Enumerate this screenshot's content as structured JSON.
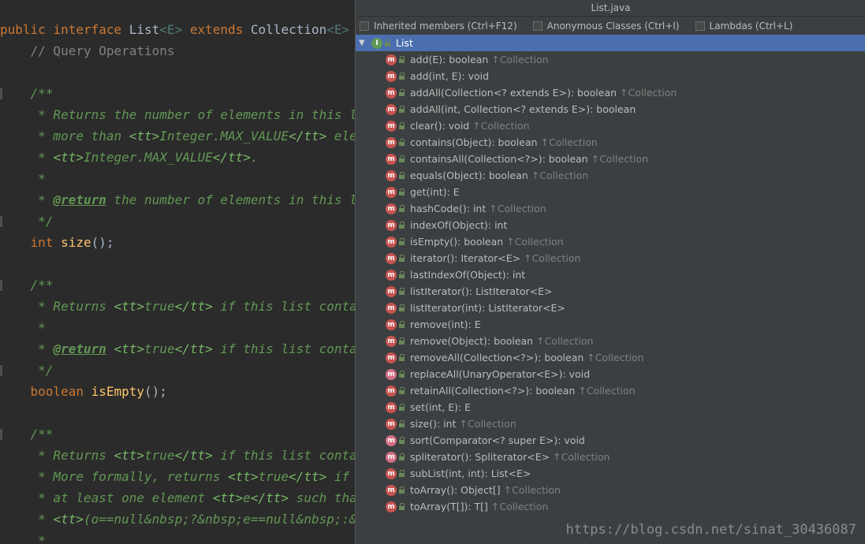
{
  "editor": {
    "lines": [
      [
        {
          "t": "public ",
          "c": "kw"
        },
        {
          "t": "interface ",
          "c": "kw"
        },
        {
          "t": "List",
          "c": "cls"
        },
        {
          "t": "<E>",
          "c": "typep"
        },
        {
          "t": " extends ",
          "c": "kw"
        },
        {
          "t": "Collection",
          "c": "cls"
        },
        {
          "t": "<E>",
          "c": "typep"
        },
        {
          "t": " ",
          "c": "cls"
        },
        {
          "t": "{",
          "c": "brace-hl"
        }
      ],
      [
        {
          "t": "    // Query Operations",
          "c": "cmt-plain"
        }
      ],
      [
        {
          "t": "",
          "c": "cls"
        }
      ],
      [
        {
          "t": "    /**",
          "c": "doc"
        }
      ],
      [
        {
          "t": "     * Returns the number of elements in this list",
          "c": "doc"
        }
      ],
      [
        {
          "t": "     * more than ",
          "c": "doc"
        },
        {
          "t": "<tt>",
          "c": "doc-html"
        },
        {
          "t": "Integer.MAX_VALUE",
          "c": "doc"
        },
        {
          "t": "</tt>",
          "c": "doc-html"
        },
        {
          "t": " elements",
          "c": "doc"
        }
      ],
      [
        {
          "t": "     * ",
          "c": "doc"
        },
        {
          "t": "<tt>",
          "c": "doc-html"
        },
        {
          "t": "Integer.MAX_VALUE",
          "c": "doc"
        },
        {
          "t": "</tt>",
          "c": "doc-html"
        },
        {
          "t": ".",
          "c": "doc"
        }
      ],
      [
        {
          "t": "     *",
          "c": "doc"
        }
      ],
      [
        {
          "t": "     * ",
          "c": "doc"
        },
        {
          "t": "@return",
          "c": "doc-tag"
        },
        {
          "t": " the number of elements in this list",
          "c": "doc"
        }
      ],
      [
        {
          "t": "     */",
          "c": "doc"
        }
      ],
      [
        {
          "t": "    int ",
          "c": "kw"
        },
        {
          "t": "size",
          "c": "fn"
        },
        {
          "t": "();",
          "c": "cls"
        }
      ],
      [
        {
          "t": "",
          "c": "cls"
        }
      ],
      [
        {
          "t": "    /**",
          "c": "doc"
        }
      ],
      [
        {
          "t": "     * Returns ",
          "c": "doc"
        },
        {
          "t": "<tt>",
          "c": "doc-html"
        },
        {
          "t": "true",
          "c": "doc"
        },
        {
          "t": "</tt>",
          "c": "doc-html"
        },
        {
          "t": " if this list contains",
          "c": "doc"
        }
      ],
      [
        {
          "t": "     *",
          "c": "doc"
        }
      ],
      [
        {
          "t": "     * ",
          "c": "doc"
        },
        {
          "t": "@return",
          "c": "doc-tag"
        },
        {
          "t": " ",
          "c": "doc"
        },
        {
          "t": "<tt>",
          "c": "doc-html"
        },
        {
          "t": "true",
          "c": "doc"
        },
        {
          "t": "</tt>",
          "c": "doc-html"
        },
        {
          "t": " if this list contains",
          "c": "doc"
        }
      ],
      [
        {
          "t": "     */",
          "c": "doc"
        }
      ],
      [
        {
          "t": "    boolean ",
          "c": "kw"
        },
        {
          "t": "isEmpty",
          "c": "fn"
        },
        {
          "t": "();",
          "c": "cls"
        }
      ],
      [
        {
          "t": "",
          "c": "cls"
        }
      ],
      [
        {
          "t": "    /**",
          "c": "doc"
        }
      ],
      [
        {
          "t": "     * Returns ",
          "c": "doc"
        },
        {
          "t": "<tt>",
          "c": "doc-html"
        },
        {
          "t": "true",
          "c": "doc"
        },
        {
          "t": "</tt>",
          "c": "doc-html"
        },
        {
          "t": " if this list contains",
          "c": "doc"
        }
      ],
      [
        {
          "t": "     * More formally, returns ",
          "c": "doc"
        },
        {
          "t": "<tt>",
          "c": "doc-html"
        },
        {
          "t": "true",
          "c": "doc"
        },
        {
          "t": "</tt>",
          "c": "doc-html"
        },
        {
          "t": " if and",
          "c": "doc"
        }
      ],
      [
        {
          "t": "     * at least one element ",
          "c": "doc"
        },
        {
          "t": "<tt>",
          "c": "doc-html"
        },
        {
          "t": "e",
          "c": "doc"
        },
        {
          "t": "</tt>",
          "c": "doc-html"
        },
        {
          "t": " such that",
          "c": "doc"
        }
      ],
      [
        {
          "t": "     * ",
          "c": "doc"
        },
        {
          "t": "<tt>",
          "c": "doc-html"
        },
        {
          "t": "(o==null&nbsp;?&nbsp;e==null&nbsp;:&nbsp;",
          "c": "doc"
        }
      ],
      [
        {
          "t": "     *",
          "c": "doc"
        }
      ]
    ]
  },
  "popup": {
    "title": "List.java",
    "filters": [
      {
        "label": "Inherited members (Ctrl+F12)",
        "checked": false
      },
      {
        "label": "Anonymous Classes (Ctrl+I)",
        "checked": false
      },
      {
        "label": "Lambdas (Ctrl+L)",
        "checked": false
      }
    ],
    "root": {
      "label": "List",
      "icon": "interface-icon"
    },
    "members": [
      {
        "sig": "add(E): boolean",
        "inh": "↑Collection",
        "default": false
      },
      {
        "sig": "add(int, E): void",
        "inh": "",
        "default": false
      },
      {
        "sig": "addAll(Collection<? extends E>): boolean",
        "inh": "↑Collection",
        "default": false
      },
      {
        "sig": "addAll(int, Collection<? extends E>): boolean",
        "inh": "",
        "default": false
      },
      {
        "sig": "clear(): void",
        "inh": "↑Collection",
        "default": false
      },
      {
        "sig": "contains(Object): boolean",
        "inh": "↑Collection",
        "default": false
      },
      {
        "sig": "containsAll(Collection<?>): boolean",
        "inh": "↑Collection",
        "default": false
      },
      {
        "sig": "equals(Object): boolean",
        "inh": "↑Collection",
        "default": false
      },
      {
        "sig": "get(int): E",
        "inh": "",
        "default": false
      },
      {
        "sig": "hashCode(): int",
        "inh": "↑Collection",
        "default": false
      },
      {
        "sig": "indexOf(Object): int",
        "inh": "",
        "default": false
      },
      {
        "sig": "isEmpty(): boolean",
        "inh": "↑Collection",
        "default": false
      },
      {
        "sig": "iterator(): Iterator<E>",
        "inh": "↑Collection",
        "default": false
      },
      {
        "sig": "lastIndexOf(Object): int",
        "inh": "",
        "default": false
      },
      {
        "sig": "listIterator(): ListIterator<E>",
        "inh": "",
        "default": false
      },
      {
        "sig": "listIterator(int): ListIterator<E>",
        "inh": "",
        "default": false
      },
      {
        "sig": "remove(int): E",
        "inh": "",
        "default": false
      },
      {
        "sig": "remove(Object): boolean",
        "inh": "↑Collection",
        "default": false
      },
      {
        "sig": "removeAll(Collection<?>): boolean",
        "inh": "↑Collection",
        "default": false
      },
      {
        "sig": "replaceAll(UnaryOperator<E>): void",
        "inh": "",
        "default": true
      },
      {
        "sig": "retainAll(Collection<?>): boolean",
        "inh": "↑Collection",
        "default": false
      },
      {
        "sig": "set(int, E): E",
        "inh": "",
        "default": false
      },
      {
        "sig": "size(): int",
        "inh": "↑Collection",
        "default": false
      },
      {
        "sig": "sort(Comparator<? super E>): void",
        "inh": "",
        "default": true
      },
      {
        "sig": "spliterator(): Spliterator<E>",
        "inh": "↑Collection",
        "default": true
      },
      {
        "sig": "subList(int, int): List<E>",
        "inh": "",
        "default": false
      },
      {
        "sig": "toArray(): Object[]",
        "inh": "↑Collection",
        "default": false
      },
      {
        "sig": "toArray(T[]): T[]",
        "inh": "↑Collection",
        "default": false
      }
    ]
  },
  "watermark": "https://blog.csdn.net/sinat_30436087",
  "colors": {
    "selection": "#4b6eaf",
    "method_icon": "#c75450",
    "interface_icon": "#629755"
  }
}
